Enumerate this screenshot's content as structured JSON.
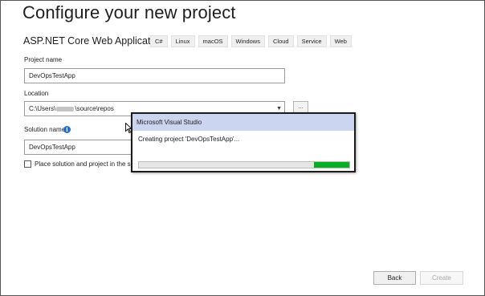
{
  "header": {
    "title": "Configure your new project",
    "template_name": "ASP.NET Core Web Application",
    "tags": [
      "C#",
      "Linux",
      "macOS",
      "Windows",
      "Cloud",
      "Service",
      "Web"
    ]
  },
  "form": {
    "project_name_label": "Project name",
    "project_name_value": "DevOpsTestApp",
    "location_label": "Location",
    "location_prefix": "C:\\Users\\",
    "location_suffix": "\\source\\repos",
    "browse_label": "...",
    "solution_name_label": "Solution name",
    "info_glyph": "i",
    "solution_name_value": "DevOpsTestApp",
    "checkbox_label": "Place solution and project in the same",
    "checkbox_checked": false
  },
  "buttons": {
    "back_label": "Back",
    "create_label": "Create"
  },
  "dialog": {
    "title": "Microsoft Visual Studio",
    "message": "Creating project 'DevOpsTestApp'...",
    "progress_position": 0.832,
    "progress_width": 0.168,
    "progress_color": "#06b025"
  }
}
